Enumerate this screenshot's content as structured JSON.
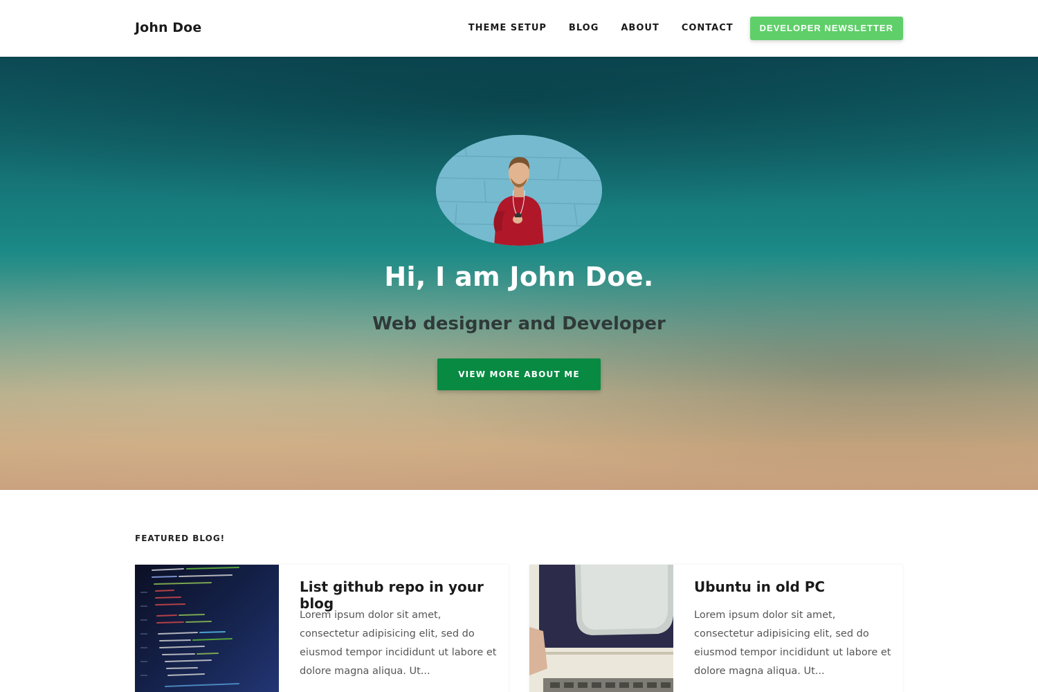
{
  "nav": {
    "brand": "John Doe",
    "links": [
      "THEME SETUP",
      "BLOG",
      "ABOUT",
      "CONTACT"
    ],
    "cta": "DEVELOPER NEWSLETTER"
  },
  "hero": {
    "title": "Hi, I am John Doe.",
    "subtitle": "Web designer and Developer",
    "button": "VIEW MORE ABOUT ME"
  },
  "featured": {
    "heading": "FEATURED BLOG!",
    "posts": [
      {
        "title": "List github repo in your blog",
        "excerpt": "Lorem ipsum dolor sit amet, consectetur adipisicing elit, sed do eiusmod tempor incididunt ut labore et dolore magna aliqua. Ut..."
      },
      {
        "title": "Ubuntu in old PC",
        "excerpt": "Lorem ipsum dolor sit amet, consectetur adipisicing elit, sed do eiusmod tempor incididunt ut labore et dolore magna aliqua. Ut..."
      }
    ]
  },
  "colors": {
    "accent_green": "#5fcf6a",
    "button_green": "#088a43",
    "hero_top": "#0d4d57",
    "hero_bottom": "#c89f7e"
  }
}
